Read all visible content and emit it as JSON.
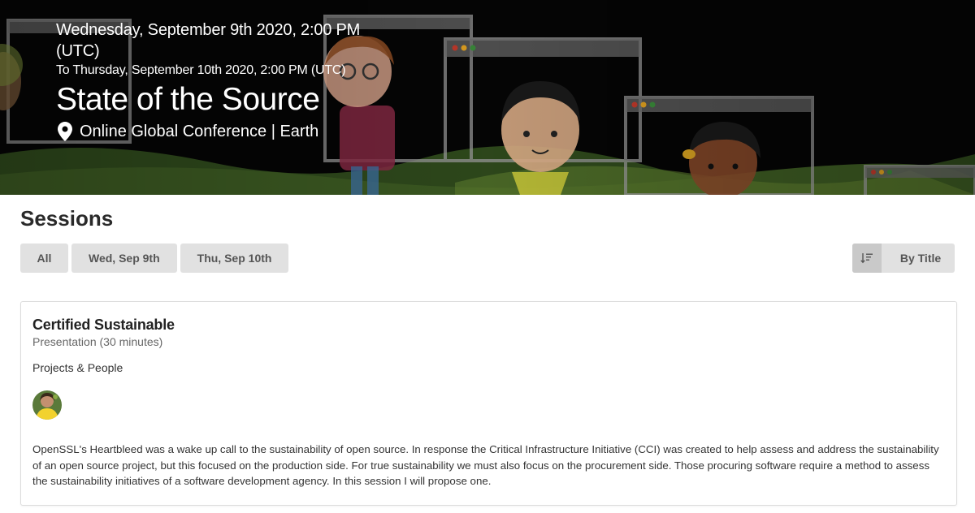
{
  "event": {
    "date_start": "Wednesday, September 9th 2020, 2:00 PM (UTC)",
    "date_end": "To Thursday, September 10th 2020, 2:00 PM (UTC)",
    "title": "State of the Source",
    "location": "Online Global Conference | Earth",
    "location_icon": "map-pin-icon"
  },
  "sessions": {
    "heading": "Sessions",
    "filters": [
      "All",
      "Wed, Sep 9th",
      "Thu, Sep 10th"
    ],
    "sort_label": "By Title",
    "sort_icon": "sort-icon"
  },
  "session_card": {
    "title": "Certified Sustainable",
    "subtitle": "Presentation (30 minutes)",
    "track": "Projects & People",
    "speaker_avatar": "speaker-avatar",
    "description": "OpenSSL's Heartbleed was a wake up call to the sustainability of open source. In response the Critical Infrastructure Initiative (CCI) was created to help assess and address the sustainability of an open source project, but this focused on the production side. For true sustainability we must also focus on the procurement side. Those procuring software require a method to assess the sustainability initiatives of a software development agency. In this session I will propose one."
  },
  "colors": {
    "hero_bg": "#050505",
    "chip_bg": "#e1e1e1",
    "sort_icon_bg": "#c9c9c9",
    "text_dark": "#2a2a2a",
    "accent_yellow": "#f2d22e"
  }
}
